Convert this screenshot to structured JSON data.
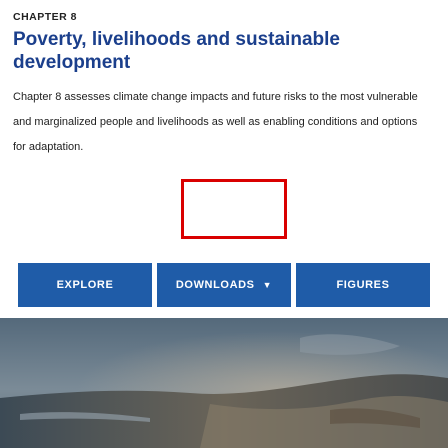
{
  "chapter": {
    "eyebrow": "CHAPTER 8",
    "title": "Poverty, livelihoods and sustainable development",
    "description": "Chapter 8 assesses climate change impacts and future risks to the most vulnerable and marginalized people and livelihoods as well as enabling conditions and options for adaptation."
  },
  "buttons": {
    "explore": "EXPLORE",
    "downloads": "DOWNLOADS",
    "figures": "FIGURES"
  },
  "icons": {
    "downloads_dropdown": "chevron-down-icon"
  },
  "colors": {
    "button_bg": "#1f5ca8",
    "title": "#1b3f8c",
    "highlight_border": "#d90000"
  }
}
